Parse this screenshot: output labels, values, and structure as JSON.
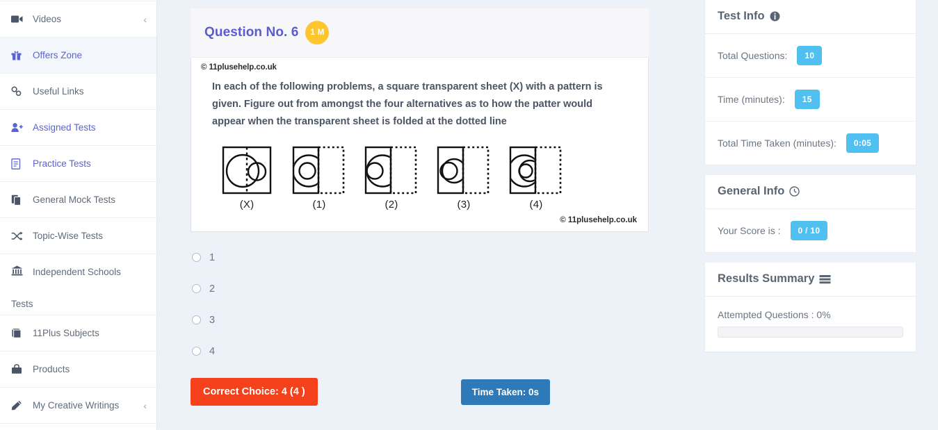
{
  "sidebar": {
    "items": [
      {
        "label": "Videos",
        "icon": "video-icon",
        "active": false,
        "accent": false,
        "chevron": "‹"
      },
      {
        "label": "Offers Zone",
        "icon": "gift-icon",
        "active": true,
        "accent": true,
        "chevron": ""
      },
      {
        "label": "Useful Links",
        "icon": "link-icon",
        "active": false,
        "accent": false,
        "chevron": ""
      },
      {
        "label": "Assigned Tests",
        "icon": "user-plus-icon",
        "active": false,
        "accent": true,
        "chevron": ""
      },
      {
        "label": "Practice Tests",
        "icon": "document-icon",
        "active": false,
        "accent": true,
        "chevron": ""
      },
      {
        "label": "General Mock Tests",
        "icon": "copy-icon",
        "active": false,
        "accent": false,
        "chevron": ""
      },
      {
        "label": "Topic-Wise Tests",
        "icon": "shuffle-icon",
        "active": false,
        "accent": false,
        "chevron": ""
      },
      {
        "label": "Independent Schools",
        "label2": "Tests",
        "icon": "bank-icon",
        "active": false,
        "accent": false,
        "chevron": ""
      },
      {
        "label": "11Plus Subjects",
        "icon": "book-icon",
        "active": false,
        "accent": false,
        "chevron": ""
      },
      {
        "label": "Products",
        "icon": "bag-icon",
        "active": false,
        "accent": false,
        "chevron": ""
      },
      {
        "label": "My Creative Writings",
        "icon": "pencil-icon",
        "active": false,
        "accent": false,
        "chevron": "‹"
      }
    ]
  },
  "question": {
    "title": "Question No. 6",
    "marks_badge": "1 M",
    "watermark_top": "© 11plusehelp.co.uk",
    "watermark_bottom": "© 11plusehelp.co.uk",
    "text": "In each of the following problems, a square transparent sheet (X) with a pattern is given. Figure out from amongst the four alternatives as to how the patter would appear when the transparent sheet is folded at the dotted line",
    "figures": [
      {
        "label": "(X)",
        "type": "source"
      },
      {
        "label": "(1)",
        "type": "option-1"
      },
      {
        "label": "(2)",
        "type": "option-2"
      },
      {
        "label": "(3)",
        "type": "option-3"
      },
      {
        "label": "(4)",
        "type": "option-4"
      }
    ],
    "options": [
      {
        "value": "1",
        "selected": false
      },
      {
        "value": "2",
        "selected": false
      },
      {
        "value": "3",
        "selected": false
      },
      {
        "value": "4",
        "selected": false
      }
    ],
    "correct_choice_label": "Correct Choice: 4 (4 )",
    "time_taken_label": "Time Taken: 0s"
  },
  "test_info": {
    "heading": "Test Info",
    "heading_icon": "info-circle-icon",
    "rows": [
      {
        "label": "Total Questions:",
        "value": "10"
      },
      {
        "label": "Time (minutes):",
        "value": "15"
      },
      {
        "label": "Total Time Taken (minutes):",
        "value": "0:05"
      }
    ]
  },
  "general_info": {
    "heading": "General Info",
    "heading_icon": "clock-icon",
    "rows": [
      {
        "label": "Your Score is :",
        "value": "0 / 10"
      }
    ]
  },
  "results_summary": {
    "heading": "Results Summary",
    "heading_icon": "list-icon",
    "attempted_label": "Attempted Questions : 0%",
    "attempted_percent": 0
  },
  "colors": {
    "accent_purple": "#5b5bd0",
    "badge_yellow": "#fdc62e",
    "pill_blue": "#4fc0f0",
    "correct_red": "#f4401b",
    "time_blue": "#2e7ab8",
    "page_bg": "#edf2f8"
  }
}
